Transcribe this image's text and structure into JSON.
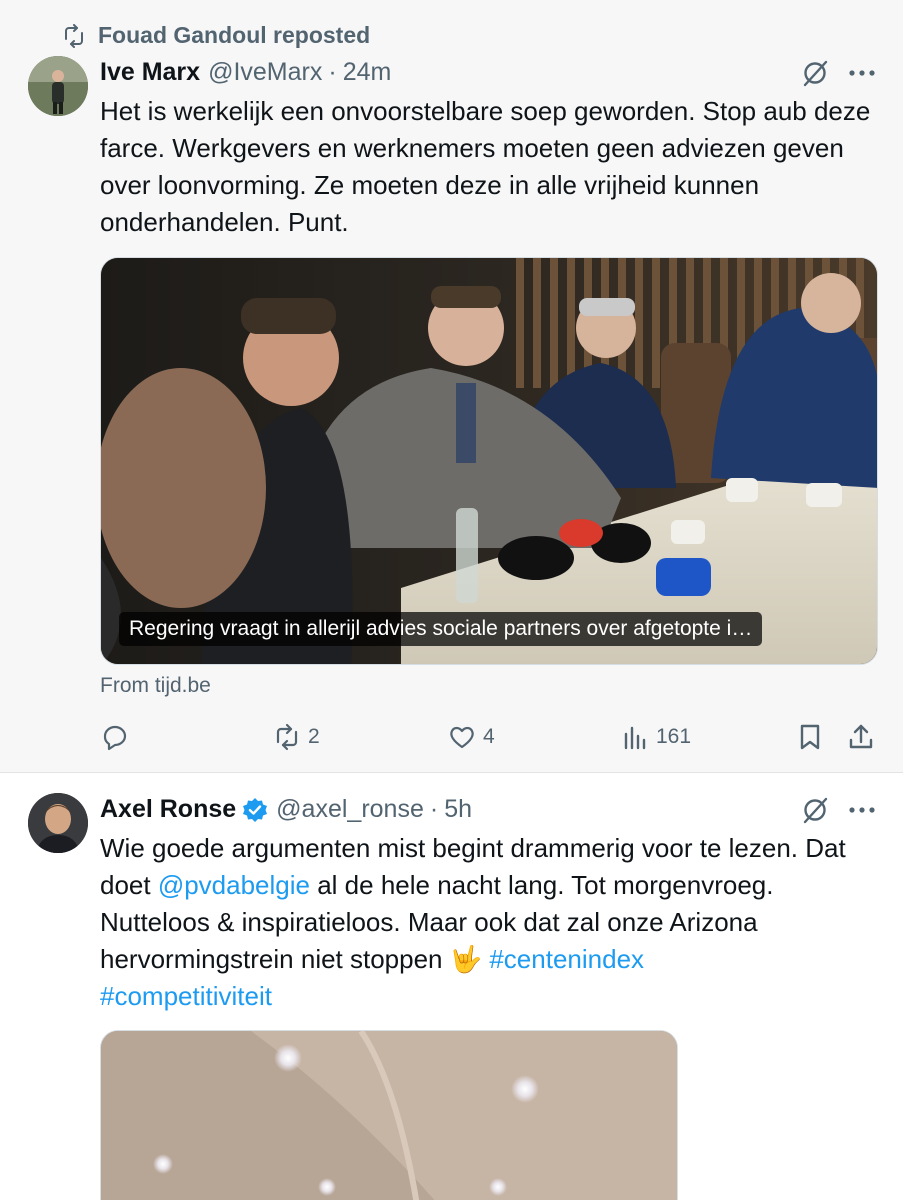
{
  "tweets": [
    {
      "repost_label": "Fouad Gandoul reposted",
      "author_name": "Ive Marx",
      "handle": "@IveMarx",
      "separator": "·",
      "time": "24m",
      "text": "Het is werkelijk een onvoorstelbare soep geworden. Stop aub deze farce. Werkgevers en werknemers moeten geen adviezen geven over loonvorming. Ze moeten deze in alle vrijheid kunnen onderhandelen. Punt.",
      "media_caption": "Regering vraagt in allerijl advies sociale partners over afgetopte i…",
      "source": "From tijd.be",
      "actions": {
        "reply_count": "",
        "repost_count": "2",
        "like_count": "4",
        "view_count": "161"
      }
    },
    {
      "author_name": "Axel Ronse",
      "handle": "@axel_ronse",
      "separator": "·",
      "time": "5h",
      "text_part1": "Wie goede argumenten mist begint drammerig voor te lezen. Dat doet ",
      "mention": "@pvdabelgie",
      "text_part2": " al de hele nacht lang. Tot morgenvroeg. Nutteloos & inspiratieloos. Maar ook dat zal onze Arizona hervormingstrein niet stoppen 🤟 ",
      "hashtag1": "#centenindex",
      "hashtag2": "#competitiviteit"
    }
  ],
  "colors": {
    "link": "#1d9bf0",
    "secondary_text": "#536471",
    "verified": "#1d9bf0"
  },
  "icons": [
    "repost-icon",
    "grok-icon",
    "more-icon",
    "reply-icon",
    "like-icon",
    "views-icon",
    "bookmark-icon",
    "share-icon",
    "verified-badge-icon"
  ]
}
